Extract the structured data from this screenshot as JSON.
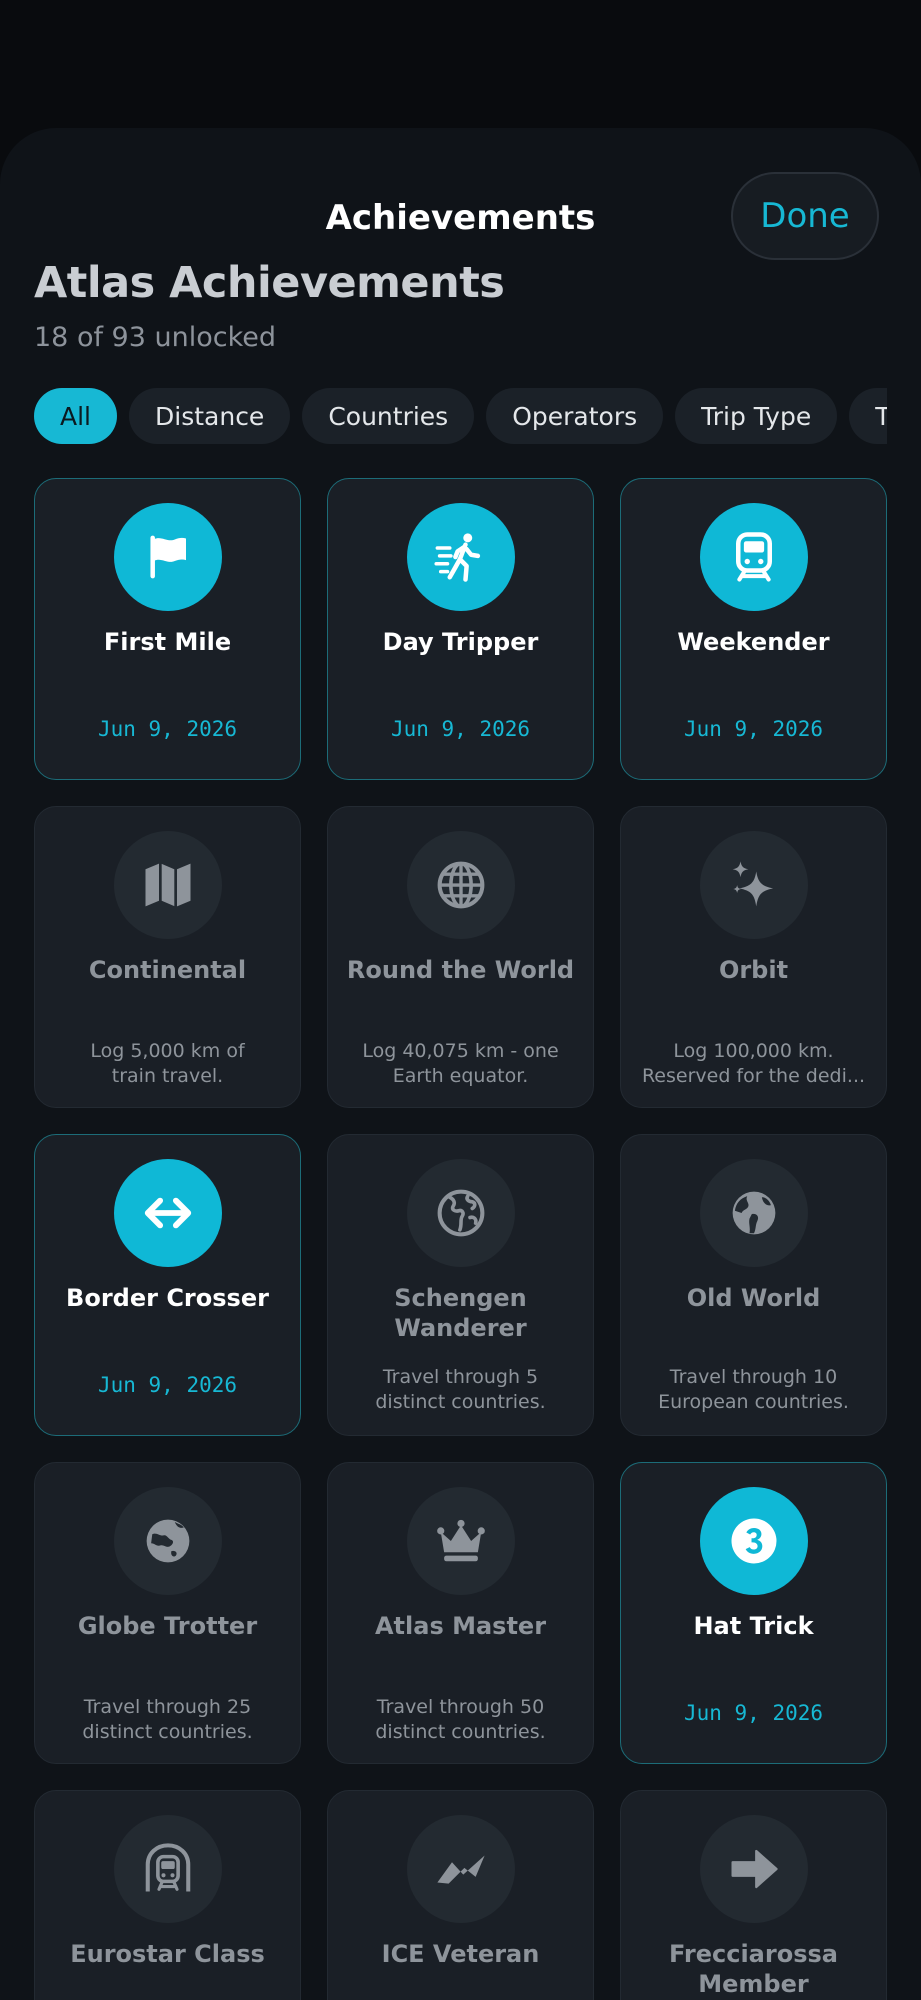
{
  "header": {
    "nav_title": "Achievements",
    "done_label": "Done",
    "title": "Atlas Achievements",
    "subtitle": "18 of 93 unlocked"
  },
  "filters": [
    "All",
    "Distance",
    "Countries",
    "Operators",
    "Trip Type",
    "Time"
  ],
  "active_filter": "All",
  "colors": {
    "accent": "#17b8d4",
    "background": "#0f1318",
    "card": "#1a1f26",
    "locked_text": "#8e949b"
  },
  "achievements": [
    {
      "name": "First Mile",
      "icon": "flag-icon",
      "unlocked": true,
      "date": "Jun 9, 2026"
    },
    {
      "name": "Day Tripper",
      "icon": "running-figure-icon",
      "unlocked": true,
      "date": "Jun 9, 2026"
    },
    {
      "name": "Weekender",
      "icon": "train-icon",
      "unlocked": true,
      "date": "Jun 9, 2026"
    },
    {
      "name": "Continental",
      "icon": "map-icon",
      "unlocked": false,
      "desc_line1": "Log 5,000 km of",
      "desc_line2": "train travel."
    },
    {
      "name": "Round the World",
      "icon": "globe-grid-icon",
      "unlocked": false,
      "desc_line1": "Log 40,075 km - one",
      "desc_line2": "Earth equator."
    },
    {
      "name": "Orbit",
      "icon": "sparkles-icon",
      "unlocked": false,
      "desc_line1": "Log 100,000 km.",
      "desc_line2": "Reserved for the dedi..."
    },
    {
      "name": "Border Crosser",
      "icon": "left-right-arrow-icon",
      "unlocked": true,
      "date": "Jun 9, 2026"
    },
    {
      "name_line1": "Schengen",
      "name_line2": "Wanderer",
      "icon": "globe-europe-outline-icon",
      "unlocked": false,
      "desc_line1": "Travel through 5",
      "desc_line2": "distinct countries."
    },
    {
      "name": "Old World",
      "icon": "globe-europe-filled-icon",
      "unlocked": false,
      "desc_line1": "Travel through 10",
      "desc_line2": "European countries."
    },
    {
      "name": "Globe Trotter",
      "icon": "globe-asia-icon",
      "unlocked": false,
      "desc_line1": "Travel through 25",
      "desc_line2": "distinct countries."
    },
    {
      "name": "Atlas Master",
      "icon": "crown-icon",
      "unlocked": false,
      "desc_line1": "Travel through 50",
      "desc_line2": "distinct countries."
    },
    {
      "name": "Hat Trick",
      "icon": "number-three-icon",
      "unlocked": true,
      "date": "Jun 9, 2026"
    },
    {
      "name": "Eurostar Class",
      "icon": "tunnel-train-icon",
      "unlocked": false
    },
    {
      "name": "ICE Veteran",
      "icon": "zigzag-icon",
      "unlocked": false
    },
    {
      "name_line1": "Frecciarossa",
      "name_line2": "Member",
      "icon": "arrow-right-icon",
      "unlocked": false
    }
  ]
}
